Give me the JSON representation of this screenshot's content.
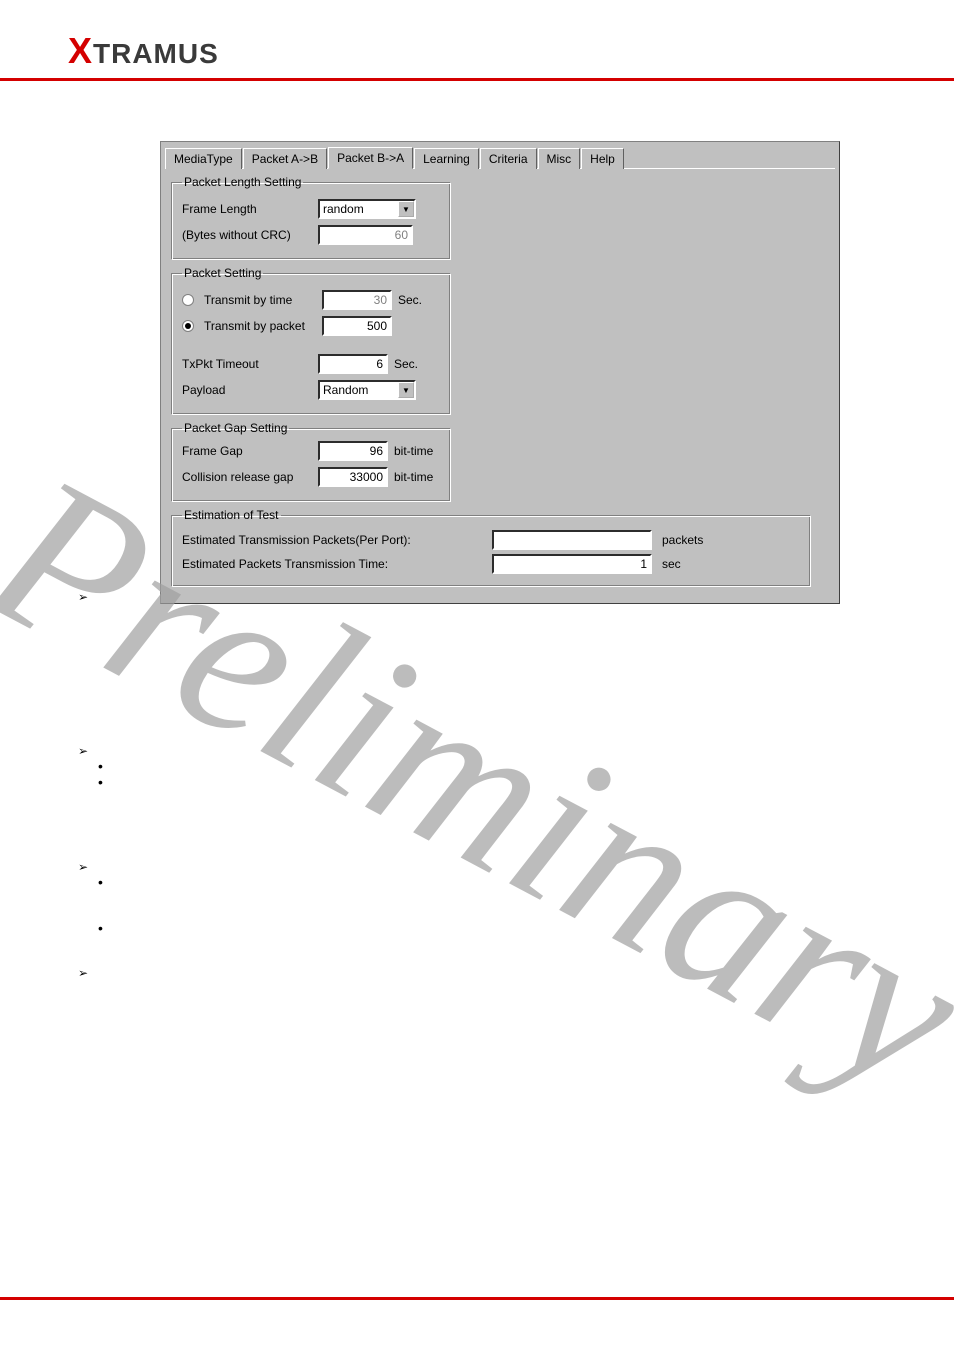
{
  "logo": {
    "x": "X",
    "rest": "TRAMUS"
  },
  "tabs": [
    "MediaType",
    "Packet A->B",
    "Packet B->A",
    "Learning",
    "Criteria",
    "Misc",
    "Help"
  ],
  "active_tab_index": 2,
  "packet_length_setting": {
    "legend": "Packet Length Setting",
    "frame_length_label": "Frame Length",
    "frame_length_select": "random",
    "bytes_label": "(Bytes without CRC)",
    "bytes_value": "60"
  },
  "packet_setting": {
    "legend": "Packet Setting",
    "transmit_by_time_label": "Transmit by time",
    "transmit_by_time_value": "30",
    "transmit_by_time_unit": "Sec.",
    "transmit_by_packet_label": "Transmit by packet",
    "transmit_by_packet_value": "500",
    "selected": "packet",
    "txpkt_timeout_label": "TxPkt Timeout",
    "txpkt_timeout_value": "6",
    "txpkt_timeout_unit": "Sec.",
    "payload_label": "Payload",
    "payload_select": "Random"
  },
  "packet_gap_setting": {
    "legend": "Packet Gap Setting",
    "frame_gap_label": "Frame Gap",
    "frame_gap_value": "96",
    "frame_gap_unit": "bit-time",
    "collision_label": "Collision release gap",
    "collision_value": "33000",
    "collision_unit": "bit-time"
  },
  "estimation": {
    "legend": "Estimation of Test",
    "packets_label": "Estimated Transmission Packets(Per Port):",
    "packets_value": "",
    "packets_unit": "packets",
    "time_label": "Estimated Packets Transmission Time:",
    "time_value": "1",
    "time_unit": "sec"
  },
  "watermark": "Preliminary"
}
